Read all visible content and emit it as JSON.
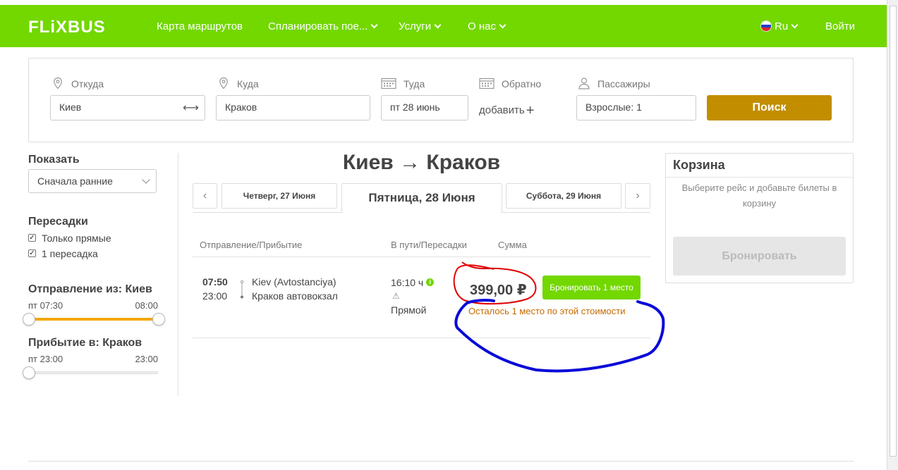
{
  "header": {
    "logo": "FLiXBUS",
    "nav": [
      {
        "label": "Карта маршрутов",
        "dropdown": false
      },
      {
        "label": "Спланировать пое...",
        "dropdown": true
      },
      {
        "label": "Услуги",
        "dropdown": true
      },
      {
        "label": "О нас",
        "dropdown": true
      }
    ],
    "language": "Ru",
    "login": "Войти"
  },
  "search": {
    "from_label": "Откуда",
    "from_value": "Киев",
    "swap_icon": "⟷",
    "to_label": "Куда",
    "to_value": "Краков",
    "depart_label": "Туда",
    "depart_value": "пт 28 июнь",
    "return_label": "Обратно",
    "return_add": "добавить",
    "passengers_label": "Пассажиры",
    "passengers_value": "Взрослые: 1",
    "search_button": "Поиск"
  },
  "filters": {
    "show_label": "Показать",
    "sort_value": "Сначала ранние",
    "transfers_label": "Пересадки",
    "transfer_options": [
      {
        "label": "Только прямые",
        "checked": true
      },
      {
        "label": "1 пересадка",
        "checked": true
      }
    ],
    "departure_label": "Отправление из: Киев",
    "departure_min": "пт 07:30",
    "departure_max": "08:00",
    "arrival_label": "Прибытие в: Краков",
    "arrival_min": "пт 23:00",
    "arrival_max": "23:00"
  },
  "results": {
    "route_title": "Киев → Краков",
    "prev_arrow": "‹",
    "next_arrow": "›",
    "dates": [
      {
        "label": "Четверг, 27 Июня",
        "active": false
      },
      {
        "label": "Пятница, 28 Июня",
        "active": true
      },
      {
        "label": "Суббота, 29 Июня",
        "active": false
      }
    ],
    "columns": {
      "departure_arrival": "Отправление/Прибытие",
      "duration_transfers": "В пути/Пересадки",
      "sum": "Сумма"
    },
    "trip": {
      "depart_time": "07:50",
      "arrive_time": "23:00",
      "depart_station": "Kiev (Avtostanciya)",
      "arrive_station": "Краков автовокзал",
      "duration": "16:10 ч",
      "info_icon": "i",
      "warning_icon": "⚠",
      "transfer_type": "Прямой",
      "price": "399,00 ₽",
      "book_button": "Бронировать 1 место",
      "seats_left": "Осталось 1 место по этой стоимости"
    }
  },
  "cart": {
    "title": "Корзина",
    "hint": "Выберите рейс и добавьте билеты в корзину",
    "book_button": "Бронировать"
  },
  "colors": {
    "brand_green": "#73d700",
    "search_button": "#c28e00",
    "slider_fill": "#f5a70a",
    "annotation_red": "#e00000",
    "annotation_blue": "#0000e0"
  }
}
